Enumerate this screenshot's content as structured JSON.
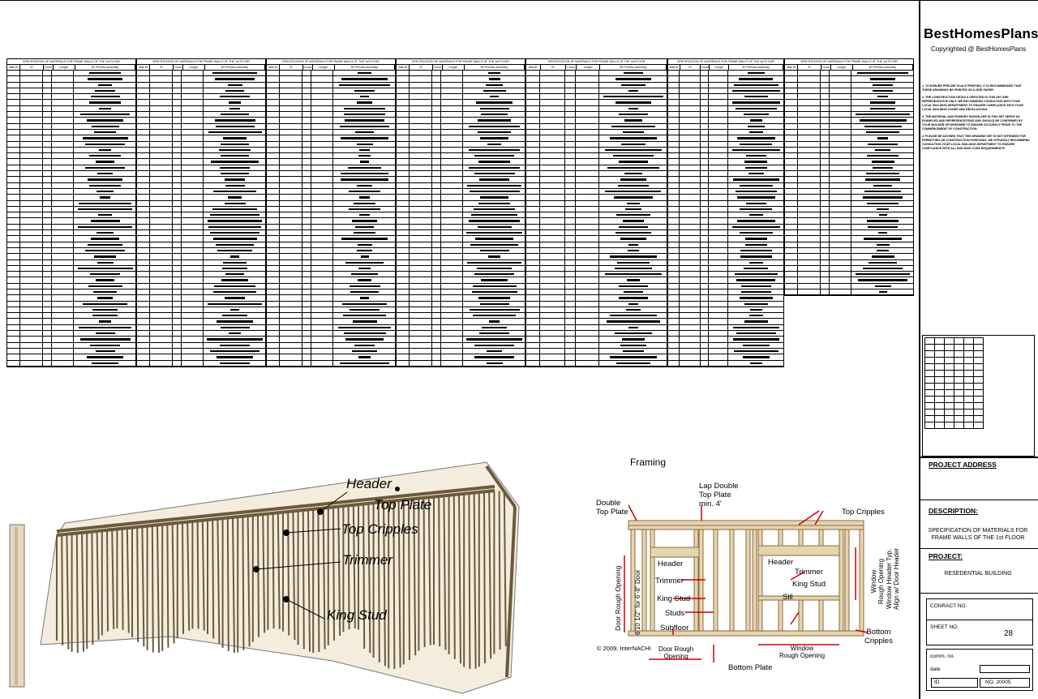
{
  "brand": {
    "name": "BestHomesPlans",
    "copyright": "Copyrighted @ BestHomesPlans"
  },
  "notes": [
    "1. TO ENSURE PRECISE SCALE PRINTING, IT IS RECOMMENDED THAT THESE DRAWINGS BE PRINTED ON D-SIZE PAPER.",
    "2. THE CONSTRUCTION DETAILS DEPICTED IN THIS SET ARE REPRESENTATIVE ONLY. WE RECOMMEND CONSULTING WITH YOUR LOCAL BUILDING DEPARTMENT TO ENSURE COMPLIANCE WITH YOUR LOCAL BUILDING CODES AND REGULATIONS.",
    "3. THE MATERIAL AND FINISHES SHOWN ARE IN THIS SET SERVE AS EXAMPLES AND REPRESENTATIONS AND SHOULD BE CONFIRMED BY YOUR BUILDER OR DESIGNER TO ENSURE ACCURACY PRIOR TO THE COMMENCEMENT OF CONSTRUCTION.",
    "4. PLEASE BE ADVISED THAT THIS DRAWING SET IS NOT INTENDED FOR PERMITTING OR CONSTRUCTION PURPOSES. WE STRONGLY RECOMMEND CONSULTING YOUR LOCAL BUILDING DEPARTMENT TO ENSURE COMPLIANCE WITH ALL BUILDING CODE REQUIREMENTS."
  ],
  "title_block": {
    "project_address_label": "PROJECT ADDRESS",
    "description_label": "DESCRIPTION:",
    "description": "SPECIFICATION OF MATERIALS FOR FRAME WALLS OF THE 1st FLOOR",
    "project_label": "PROJECT:",
    "project": "RESEDENTIAL BUILDING",
    "contract_label": "CONRACT NO.",
    "sheet_label": "SHEET NO.",
    "sheet_no": "28",
    "comm_label": "comm. no.",
    "date_label": "date",
    "id_label": "ID",
    "no_label": "NO. 20005"
  },
  "tables": {
    "caption": "SPECIFICATION OF MATERIALS FOR FRAME WALLS OF THE 1st FLOOR",
    "headers": [
      "Wall ID",
      "ID",
      "Count",
      "Length",
      "3D Preview assembly"
    ]
  },
  "callouts": {
    "header": "Header",
    "top_plate": "Top Plate",
    "top_cripples": "Top Cripples",
    "trimmer": "Trimmer",
    "king_stud": "King Stud"
  },
  "framing": {
    "title": "Framing",
    "double_top_plate": "Double\nTop Plate",
    "lap_double": "Lap Double\nTop Plate\nmin. 4'",
    "top_cripples": "Top Cripples",
    "header_left": "Header",
    "trimmer": "Trimmer",
    "king_stud_left": "King Stud",
    "studs": "Studs",
    "subfloor": "Subfloor",
    "header_right": "Header",
    "trimmer_right": "Trimmer",
    "king_stud_right": "King Stud",
    "sill": "Sill",
    "door_rough": "Door Rough Opening",
    "door_size": "6'10 1/2\" for 6'-8\" Door",
    "window_rough_v": "Window\nRough Opening",
    "window_header_typ": "Window Header Typ.\nAlign w/ Door Header",
    "bottom_cripples": "Bottom\nCripples",
    "window_rough_h": "Window\nRough Opening",
    "door_rough_h": "Door Rough\nOpening",
    "bottom_plate": "Bottom Plate",
    "copyright": "© 2009, InterNACHI"
  }
}
